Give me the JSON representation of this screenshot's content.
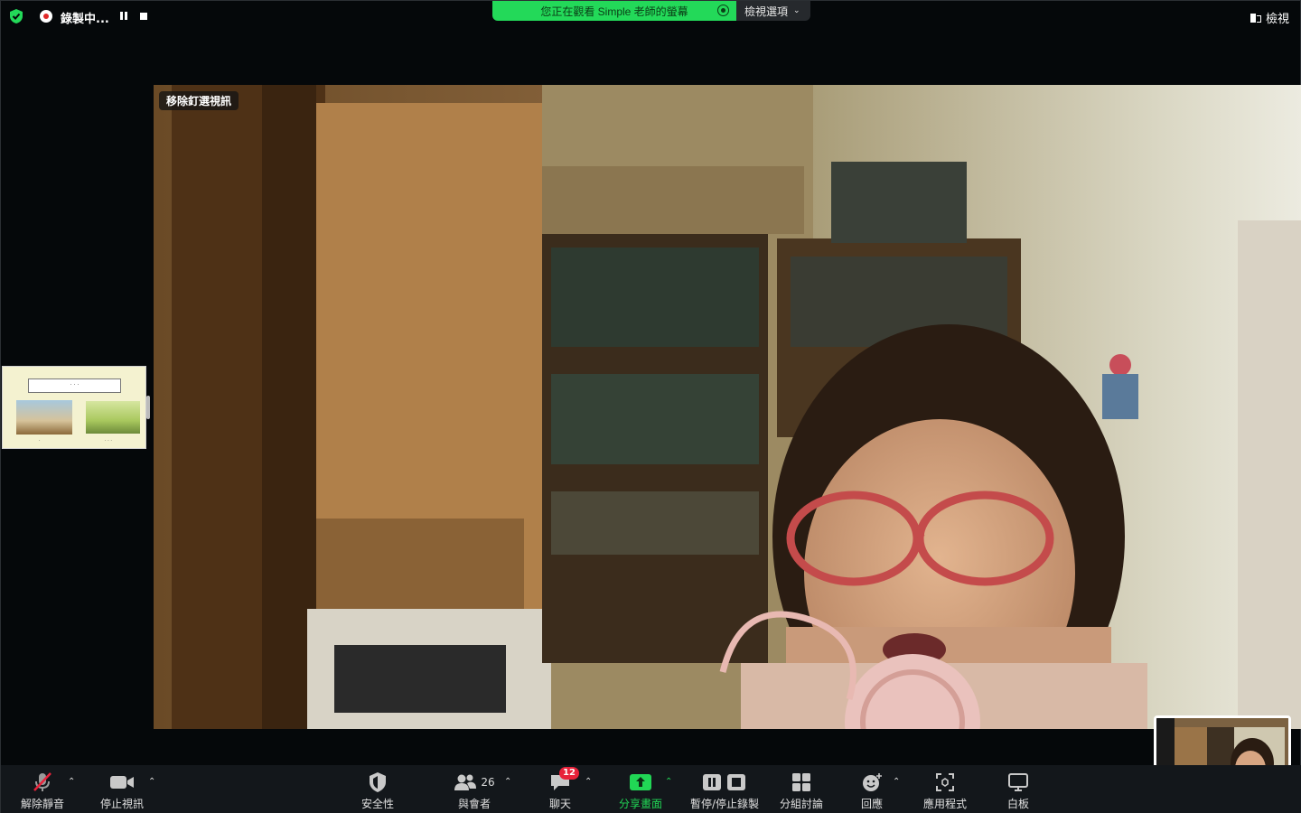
{
  "recording": {
    "label": "錄製中..."
  },
  "banner": {
    "text": "您正在觀看 Simple 老師的螢幕",
    "options_label": "檢視選項"
  },
  "view_button": {
    "label": "檢視"
  },
  "main_video": {
    "unpin_label": "移除釘選視訊"
  },
  "toolbar": {
    "unmute": "解除靜音",
    "stop_video": "停止視訊",
    "security": "安全性",
    "participants": "與會者",
    "participants_count": "26",
    "chat": "聊天",
    "chat_badge": "12",
    "share": "分享畫面",
    "pause_stop_recording": "暫停/停止錄製",
    "breakout": "分組討論",
    "reactions": "回應",
    "apps": "應用程式",
    "whiteboard": "白板"
  },
  "colors": {
    "accent_green": "#23d959",
    "badge_red": "#e8223a",
    "toolbar_bg": "#13171b"
  },
  "icons": [
    "shield-check-icon",
    "record-icon",
    "pause-icon",
    "stop-icon",
    "view-icon",
    "mic-muted-icon",
    "video-icon",
    "security-shield-icon",
    "participants-icon",
    "chat-icon",
    "share-screen-icon",
    "pause-stop-record-icon",
    "breakout-grid-icon",
    "reaction-smile-icon",
    "apps-icon",
    "whiteboard-icon"
  ]
}
